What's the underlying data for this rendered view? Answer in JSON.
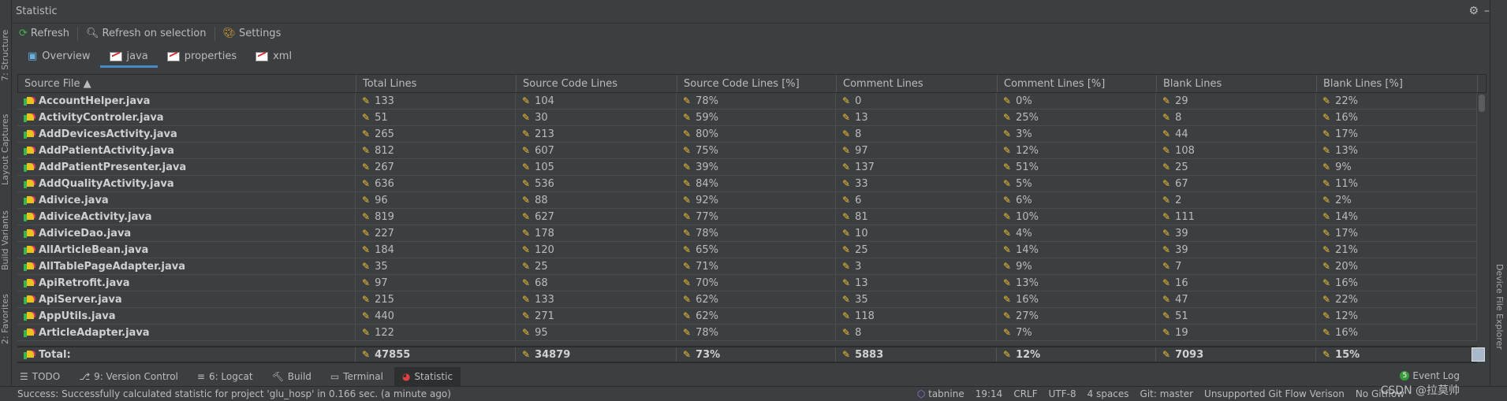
{
  "window": {
    "title": "Statistic"
  },
  "left_strip": [
    "7: Structure",
    "Layout Captures",
    "Build Variants",
    "2: Favorites"
  ],
  "right_strip": [
    "Device File Explorer"
  ],
  "toolbar": {
    "refresh": "Refresh",
    "refresh_on_selection": "Refresh on selection",
    "settings": "Settings"
  },
  "tabs": [
    {
      "label": "Overview"
    },
    {
      "label": "java",
      "active": true
    },
    {
      "label": "properties"
    },
    {
      "label": "xml"
    }
  ],
  "table": {
    "columns": [
      "Source File ▲",
      "Total Lines",
      "Source Code Lines",
      "Source Code Lines [%]",
      "Comment Lines",
      "Comment Lines [%]",
      "Blank Lines",
      "Blank Lines [%]"
    ],
    "rows": [
      [
        "AccountHelper.java",
        "133",
        "104",
        "78%",
        "0",
        "0%",
        "29",
        "22%"
      ],
      [
        "ActivityControler.java",
        "51",
        "30",
        "59%",
        "13",
        "25%",
        "8",
        "16%"
      ],
      [
        "AddDevicesActivity.java",
        "265",
        "213",
        "80%",
        "8",
        "3%",
        "44",
        "17%"
      ],
      [
        "AddPatientActivity.java",
        "812",
        "607",
        "75%",
        "97",
        "12%",
        "108",
        "13%"
      ],
      [
        "AddPatientPresenter.java",
        "267",
        "105",
        "39%",
        "137",
        "51%",
        "25",
        "9%"
      ],
      [
        "AddQualityActivity.java",
        "636",
        "536",
        "84%",
        "33",
        "5%",
        "67",
        "11%"
      ],
      [
        "Adivice.java",
        "96",
        "88",
        "92%",
        "6",
        "6%",
        "2",
        "2%"
      ],
      [
        "AdiviceActivity.java",
        "819",
        "627",
        "77%",
        "81",
        "10%",
        "111",
        "14%"
      ],
      [
        "AdiviceDao.java",
        "227",
        "178",
        "78%",
        "10",
        "4%",
        "39",
        "17%"
      ],
      [
        "AllArticleBean.java",
        "184",
        "120",
        "65%",
        "25",
        "14%",
        "39",
        "21%"
      ],
      [
        "AllTablePageAdapter.java",
        "35",
        "25",
        "71%",
        "3",
        "9%",
        "7",
        "20%"
      ],
      [
        "ApiRetrofit.java",
        "97",
        "68",
        "70%",
        "13",
        "13%",
        "16",
        "16%"
      ],
      [
        "ApiServer.java",
        "215",
        "133",
        "62%",
        "35",
        "16%",
        "47",
        "22%"
      ],
      [
        "AppUtils.java",
        "440",
        "271",
        "62%",
        "118",
        "27%",
        "51",
        "12%"
      ],
      [
        "ArticleAdapter.java",
        "122",
        "95",
        "78%",
        "8",
        "7%",
        "19",
        "16%"
      ]
    ],
    "total": [
      "Total:",
      "47855",
      "34879",
      "73%",
      "5883",
      "12%",
      "7093",
      "15%"
    ]
  },
  "tool_tabs": [
    {
      "label": "TODO"
    },
    {
      "label": "9: Version Control"
    },
    {
      "label": "6: Logcat"
    },
    {
      "label": "Build"
    },
    {
      "label": "Terminal"
    },
    {
      "label": "Statistic",
      "active": true
    }
  ],
  "event_log": {
    "count": "5",
    "label": "Event Log"
  },
  "status": {
    "message": "Success: Successfully calculated statistic for project 'glu_hosp' in 0.166 sec. (a minute ago)",
    "tabnine": "tabnine",
    "position": "19:14",
    "line_sep": "CRLF",
    "encoding": "UTF-8",
    "indent": "4 spaces",
    "git": "Git: master",
    "gitflow_warn": "Unsupported Git Flow Verison",
    "gitflow": "No Gitflow"
  },
  "watermark": "CSDN @拉莫帅",
  "colors": {
    "accent": "#4a88c7",
    "background": "#3c3f41",
    "pencil": "#f2c230"
  }
}
